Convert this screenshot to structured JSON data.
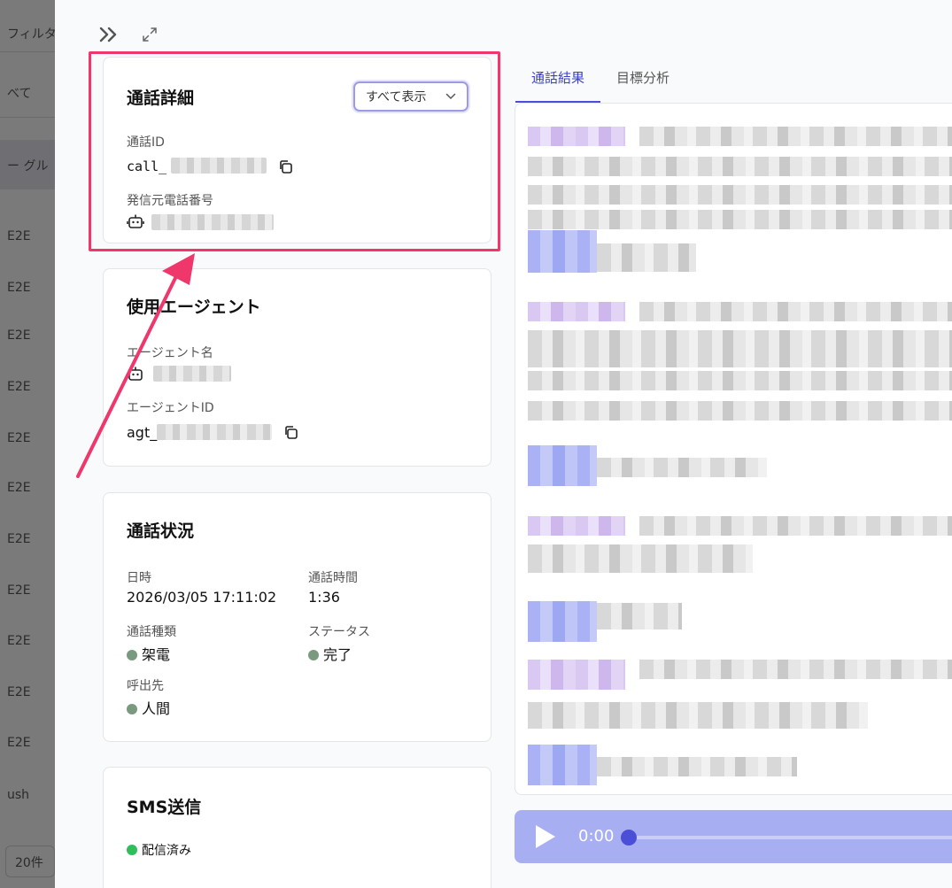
{
  "background": {
    "filter_label": "フィルタ",
    "all_label": "べて",
    "group_header": "ー グル",
    "rows": [
      "E2E",
      "E2E",
      "E2E",
      "E2E",
      "E2E",
      "E2E",
      "E2E",
      "E2E",
      "E2E",
      "E2E",
      "ush"
    ],
    "page_size_button": "20件"
  },
  "call_details": {
    "title": "通話詳細",
    "view_dropdown": "すべて表示",
    "call_id_label": "通話ID",
    "call_id_prefix": "call_",
    "from_number_label": "発信元電話番号"
  },
  "agent": {
    "title": "使用エージェント",
    "name_label": "エージェント名",
    "id_label": "エージェントID",
    "id_prefix": "agt_"
  },
  "call_status": {
    "title": "通話状況",
    "datetime_label": "日時",
    "datetime_value": "2026/03/05 17:11:02",
    "duration_label": "通話時間",
    "duration_value": "1:36",
    "type_label": "通話種類",
    "type_value": "架電",
    "status_label": "ステータス",
    "status_value": "完了",
    "callee_label": "呼出先",
    "callee_value": "人間"
  },
  "sms": {
    "title": "SMS送信",
    "status_value": "配信済み"
  },
  "tabs": [
    {
      "label": "通話結果",
      "active": true
    },
    {
      "label": "目標分析",
      "active": false
    }
  ],
  "player": {
    "time": "0:00"
  },
  "colors": {
    "accent": "#4a4fd6",
    "highlight": "#f0376c",
    "status_dot": "#7a9a7f",
    "sms_dot": "#2fbe5a"
  },
  "icons": {
    "collapse": "double-chevron-right-icon",
    "expand": "expand-arrows-icon",
    "copy": "copy-icon",
    "robot": "robot-icon",
    "play": "play-icon"
  }
}
